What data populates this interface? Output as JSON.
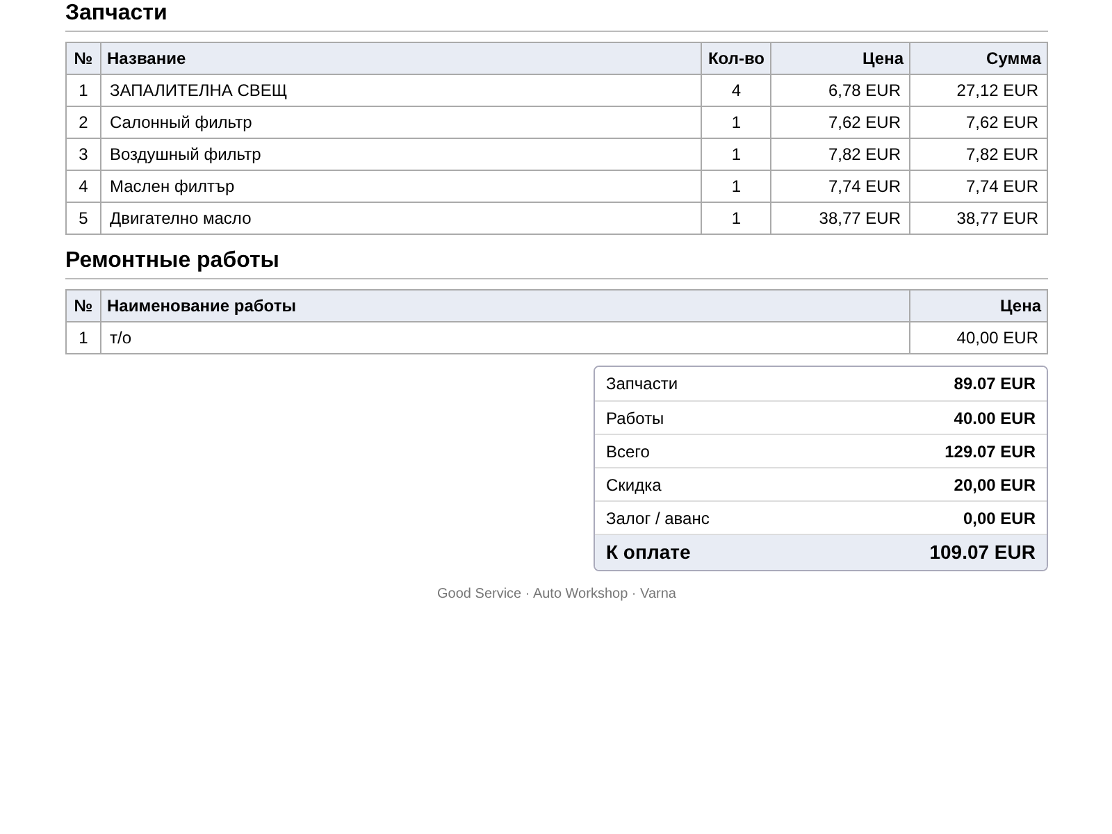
{
  "parts": {
    "title": "Запчасти",
    "columns": [
      "№",
      "Название",
      "Кол-во",
      "Цена",
      "Сумма"
    ],
    "rows": [
      [
        "1",
        "ЗАПАЛИТЕЛНА СВЕЩ",
        "4",
        "6,78 EUR",
        "27,12 EUR"
      ],
      [
        "2",
        "Салонный фильтр",
        "1",
        "7,62 EUR",
        "7,62 EUR"
      ],
      [
        "3",
        "Воздушный фильтр",
        "1",
        "7,82 EUR",
        "7,82 EUR"
      ],
      [
        "4",
        "Маслен филтър",
        "1",
        "7,74 EUR",
        "7,74 EUR"
      ],
      [
        "5",
        "Двигателно масло",
        "1",
        "38,77 EUR",
        "38,77 EUR"
      ]
    ]
  },
  "works": {
    "title": "Ремонтные работы",
    "columns": [
      "№",
      "Наименование работы",
      "Цена"
    ],
    "rows": [
      [
        "1",
        "т/о",
        "40,00 EUR"
      ]
    ]
  },
  "summary": [
    {
      "label": "Запчасти",
      "value": "89.07 EUR",
      "kind": "line"
    },
    {
      "label": "Работы",
      "value": "40.00 EUR",
      "kind": "line"
    },
    {
      "label": "Всего",
      "value": "129.07 EUR",
      "kind": "line"
    },
    {
      "label": "Скидка",
      "value": "20,00 EUR",
      "kind": "line"
    },
    {
      "label": "Залог / аванс",
      "value": "0,00 EUR",
      "kind": "line"
    },
    {
      "label": "К оплате",
      "value": "109.07 EUR",
      "kind": "total"
    }
  ],
  "footer": "Good Service · Auto Workshop · Varna"
}
